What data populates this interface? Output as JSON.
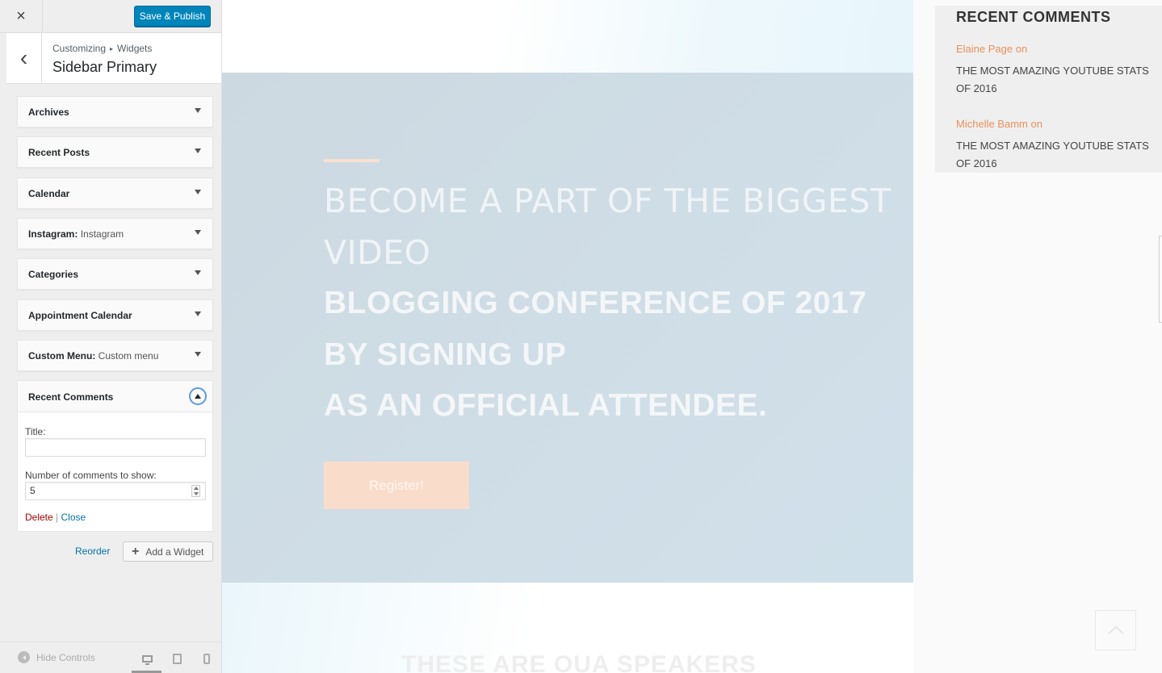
{
  "customizer": {
    "close_glyph": "×",
    "save_label": "Save & Publish",
    "back_glyph": "‹",
    "breadcrumb": [
      "Customizing",
      "▸",
      "Widgets"
    ],
    "section_title": "Sidebar Primary",
    "widgets": [
      {
        "title": "Archives",
        "subtitle": ""
      },
      {
        "title": "Recent Posts",
        "subtitle": ""
      },
      {
        "title": "Calendar",
        "subtitle": ""
      },
      {
        "title": "Instagram:",
        "subtitle": "Instagram"
      },
      {
        "title": "Categories",
        "subtitle": ""
      },
      {
        "title": "Appointment Calendar",
        "subtitle": ""
      },
      {
        "title": "Custom Menu:",
        "subtitle": "Custom menu"
      }
    ],
    "open_widget": {
      "title": "Recent Comments",
      "title_field_label": "Title:",
      "title_field_value": "",
      "number_label": "Number of comments to show:",
      "number_value": "5",
      "delete_label": "Delete",
      "separator": "|",
      "close_label": "Close"
    },
    "reorder_label": "Reorder",
    "add_widget_label": "Add a Widget",
    "add_widget_glyph": "+",
    "hide_controls_label": "Hide Controls",
    "devices": [
      "desktop",
      "tablet",
      "mobile"
    ],
    "active_device": "desktop"
  },
  "preview": {
    "hero": {
      "light_lines": [
        "BECOME A PART OF THE BIGGEST",
        "VIDEO"
      ],
      "bold_lines": [
        "BLOGGING CONFERENCE OF 2017",
        "BY SIGNING UP",
        "AS AN OFFICIAL ATTENDEE."
      ],
      "register_label": "Register!",
      "accent_color": "#f9e0d1"
    },
    "speakers_heading": "THESE ARE OUA SPEAKERS",
    "recent_comments": {
      "heading": "RECENT COMMENTS",
      "items": [
        {
          "author": "Elaine Page on",
          "post": "THE MOST AMAZING YOUTUBE STATS OF 2016"
        },
        {
          "author": "Michelle Bamm on",
          "post": "THE MOST AMAZING YOUTUBE STATS OF 2016"
        }
      ]
    }
  },
  "colors": {
    "primary_button": "#0085ba",
    "link": "#0073aa",
    "delete": "#aa0000",
    "comment_author": "#e8915a"
  }
}
